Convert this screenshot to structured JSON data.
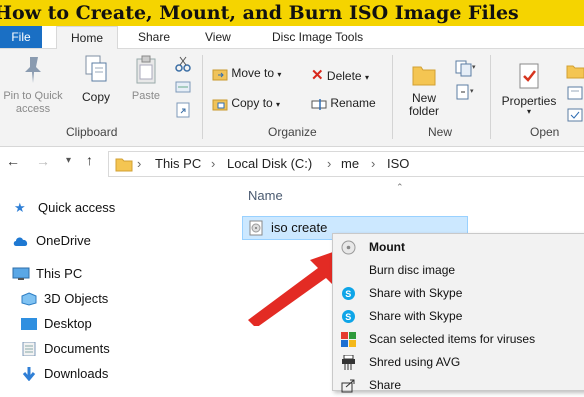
{
  "banner": {
    "title": "How to Create, Mount, and Burn ISO Image Files"
  },
  "tabs": [
    {
      "label": "File"
    },
    {
      "label": "Home"
    },
    {
      "label": "Share"
    },
    {
      "label": "View"
    },
    {
      "label": "Disc Image Tools"
    }
  ],
  "ribbon": {
    "pin_label_1": "Pin to Quick",
    "pin_label_2": "access",
    "copy": "Copy",
    "paste": "Paste",
    "clipboard_group": "Clipboard",
    "move_to": "Move to",
    "copy_to": "Copy to",
    "delete": "Delete",
    "rename": "Rename",
    "organize_group": "Organize",
    "new_folder_1": "New",
    "new_folder_2": "folder",
    "new_group": "New",
    "properties": "Properties",
    "open_group": "Open"
  },
  "address": {
    "crumbs": [
      "This PC",
      "Local Disk (C:)",
      "me",
      "ISO"
    ]
  },
  "nav": {
    "items": [
      {
        "label": "Quick access"
      },
      {
        "label": "OneDrive"
      },
      {
        "label": "This PC"
      },
      {
        "label": "3D Objects"
      },
      {
        "label": "Desktop"
      },
      {
        "label": "Documents"
      },
      {
        "label": "Downloads"
      }
    ]
  },
  "content": {
    "column_name": "Name",
    "file_name": "iso create"
  },
  "context_menu": {
    "items": [
      {
        "label": "Mount"
      },
      {
        "label": "Burn disc image"
      },
      {
        "label": "Share with Skype"
      },
      {
        "label": "Share with Skype"
      },
      {
        "label": "Scan selected items for viruses"
      },
      {
        "label": "Shred using AVG"
      },
      {
        "label": "Share"
      }
    ]
  },
  "colors": {
    "banner": "#f5d400",
    "file_tab": "#1a6fc4",
    "arrow": "#e32b24",
    "selection": "#cce8ff"
  }
}
